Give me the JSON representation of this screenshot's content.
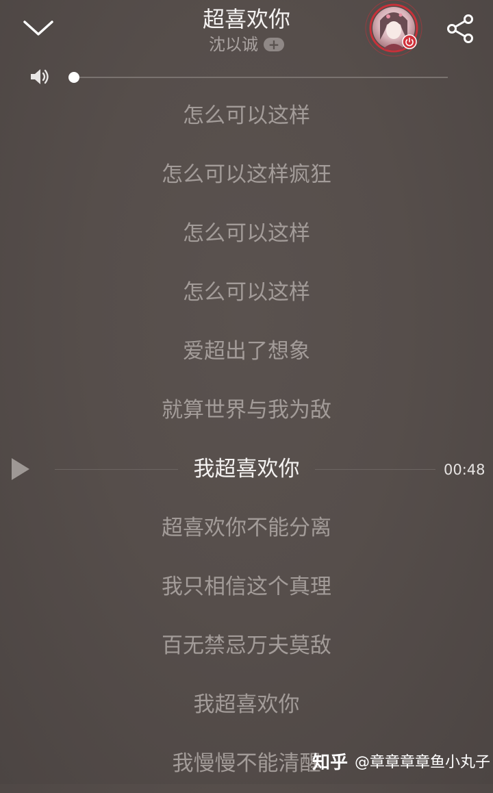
{
  "player": {
    "title": "超喜欢你",
    "artist": "沈以诚",
    "follow_symbol": "+"
  },
  "volume": {
    "level": 0.0
  },
  "lyrics": [
    "怎么可以这样",
    "怎么可以这样疯狂",
    "怎么可以这样",
    "怎么可以这样",
    "爱超出了想象",
    "就算世界与我为敌",
    "我超喜欢你",
    "超喜欢你不能分离",
    "我只相信这个真理",
    "百无禁忌万夫莫敌",
    "我超喜欢你",
    "我慢慢不能清醒"
  ],
  "active_lyric_index": 6,
  "seek": {
    "time": "00:48"
  },
  "watermark": {
    "logo": "知乎",
    "author": "@章章章章鱼小丸子"
  },
  "icons": {
    "back": "chevron-down-icon",
    "share": "share-icon",
    "volume": "speaker-icon",
    "play": "play-icon",
    "avatar_badge": "power-badge-icon"
  },
  "colors": {
    "background": "#564e4b",
    "lyric_inactive": "#a39c99",
    "lyric_active": "#f4f2f1",
    "avatar_ring": "#c8313a"
  }
}
